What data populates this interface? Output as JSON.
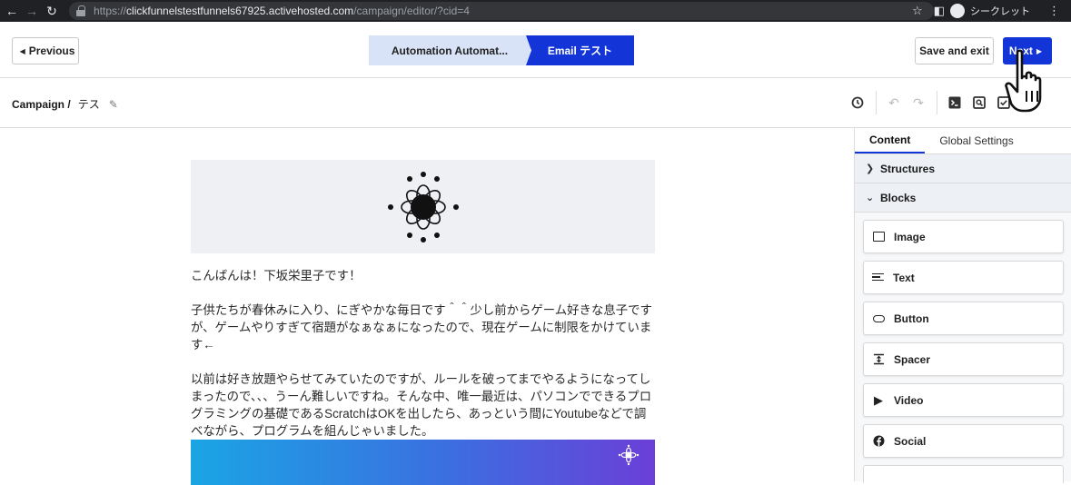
{
  "browser": {
    "url_scheme": "https://",
    "url_host": "clickfunnelstestfunnels67925.activehosted.com",
    "url_path": "/campaign/editor/?cid=4",
    "profile_label": "シークレット"
  },
  "header": {
    "previous_label": "Previous",
    "steps": [
      "Automation Automat...",
      "Email テスト"
    ],
    "save_exit_label": "Save and exit",
    "next_label": "Next"
  },
  "toolbar": {
    "crumb_root": "Campaign /",
    "crumb_name": "テス"
  },
  "email": {
    "paragraphs": [
      "こんばんは！下坂栄里子です！",
      "子供たちが春休みに入り、にぎやかな毎日です＾＾少し前からゲーム好きな息子ですが、ゲームやりすぎて宿題がなぁなぁになったので、現在ゲームに制限をかけています←",
      "以前は好き放題やらせてみていたのですが、ルールを破ってまでやるようになってしまったので、、、うーん難しいですね。そんな中、唯一最近は、パソコンでできるプログラミングの基礎であるScratchはOKを出したら、あっという間にYoutubeなどで調べながら、プログラムを組んじゃいました。"
    ]
  },
  "panel": {
    "tabs": [
      "Content",
      "Global Settings"
    ],
    "sections": [
      "Structures",
      "Blocks"
    ],
    "blocks": [
      {
        "label": "Image",
        "icon": "image-icon"
      },
      {
        "label": "Text",
        "icon": "text-icon"
      },
      {
        "label": "Button",
        "icon": "button-icon"
      },
      {
        "label": "Spacer",
        "icon": "spacer-icon"
      },
      {
        "label": "Video",
        "icon": "video-icon"
      },
      {
        "label": "Social",
        "icon": "social-icon"
      }
    ]
  },
  "colors": {
    "accent": "#1334d6",
    "step_inactive": "#d9e3f7"
  }
}
